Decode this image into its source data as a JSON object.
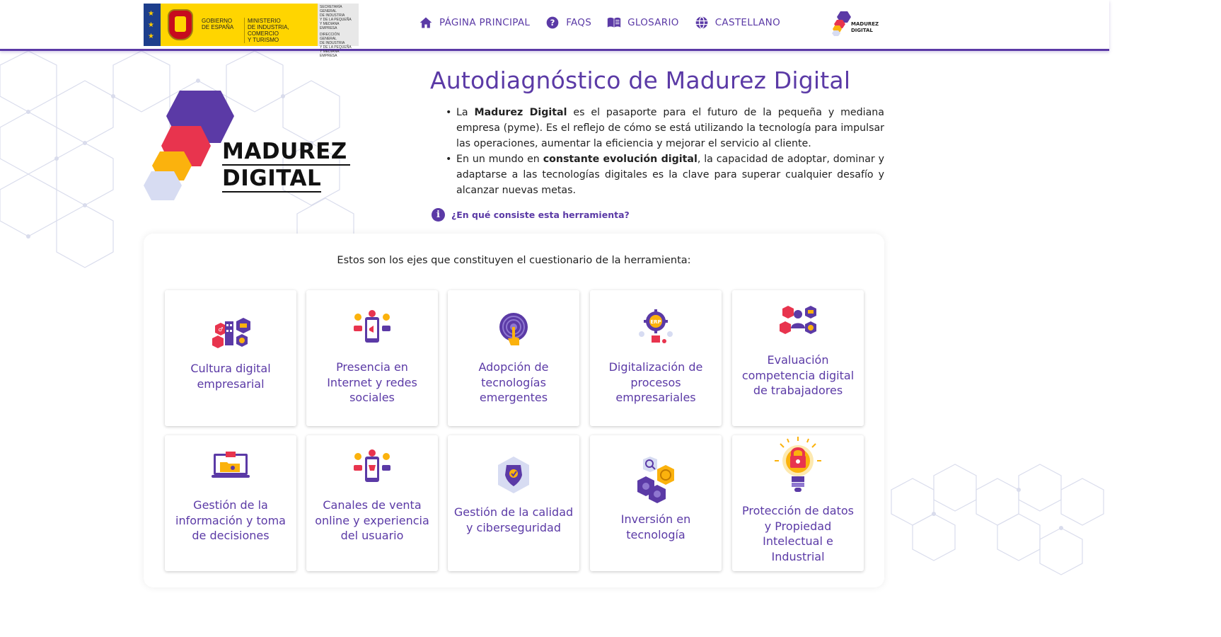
{
  "header": {
    "gov_logo": {
      "line1": "GOBIERNO",
      "line2": "DE ESPAÑA",
      "ministry": [
        "MINISTERIO",
        "DE INDUSTRIA, COMERCIO",
        "Y TURISMO"
      ],
      "secretaria": [
        "SECRETARÍA GENERAL",
        "DE INDUSTRIA",
        "Y DE LA PEQUEÑA",
        "Y MEDIANA EMPRESA"
      ],
      "direccion": [
        "DIRECCIÓN GENERAL",
        "DE INDUSTRIA",
        "Y DE LA PEQUEÑA",
        "Y MEDIANA EMPRESA"
      ]
    },
    "nav": [
      {
        "label": "PÁGINA PRINCIPAL",
        "icon": "home-icon"
      },
      {
        "label": "FAQS",
        "icon": "help-icon"
      },
      {
        "label": "GLOSARIO",
        "icon": "book-icon"
      },
      {
        "label": "CASTELLANO",
        "icon": "globe-icon"
      }
    ],
    "small_logo": {
      "line1": "MADUREZ",
      "line2": "DIGITAL"
    }
  },
  "hero": {
    "logo_line1": "MADUREZ",
    "logo_line2": "DIGITAL",
    "title": "Autodiagnóstico de Madurez Digital",
    "bullet1": {
      "pre": "La ",
      "bold": "Madurez Digital",
      "post": " es el pasaporte para el futuro de la pequeña y mediana empresa (pyme). Es el reflejo de cómo se está utilizando la tecnología para impulsar las operaciones, aumentar la eficiencia y mejorar el servicio al cliente."
    },
    "bullet2": {
      "pre": "En un mundo en ",
      "bold": "constante evolución digital",
      "post": ", la capacidad de adoptar, dominar y adaptarse a las tecnologías digitales es la clave para superar cualquier desafío y alcanzar nuevas metas."
    },
    "info_link": "¿En qué consiste esta herramienta?"
  },
  "panel": {
    "intro": "Estos son los ejes que constituyen el cuestionario de la herramienta:",
    "cards": [
      {
        "label": "Cultura digital empresarial",
        "icon": "culture-icon"
      },
      {
        "label": "Presencia en Internet y redes sociales",
        "icon": "social-media-icon"
      },
      {
        "label": "Adopción de tecnologías emergentes",
        "icon": "touch-tech-icon"
      },
      {
        "label": "Digitalización de procesos empresariales",
        "icon": "erp-gear-icon"
      },
      {
        "label": "Evaluación competencia digital de trabajadores",
        "icon": "team-skills-icon"
      },
      {
        "label": "Gestión de la información y toma de decisiones",
        "icon": "data-folder-icon"
      },
      {
        "label": "Canales de venta online y experiencia del usuario",
        "icon": "online-shop-icon"
      },
      {
        "label": "Gestión de la calidad y ciberseguridad",
        "icon": "security-shield-icon"
      },
      {
        "label": "Inversión en tecnología",
        "icon": "investment-icon"
      },
      {
        "label": "Protección de datos y Propiedad Intelectual e Industrial",
        "icon": "lock-bulb-icon"
      }
    ]
  },
  "colors": {
    "brand": "#5b3aa6",
    "red": "#e8344e",
    "orange": "#fbb20d",
    "lavender": "#d7dcf2"
  }
}
